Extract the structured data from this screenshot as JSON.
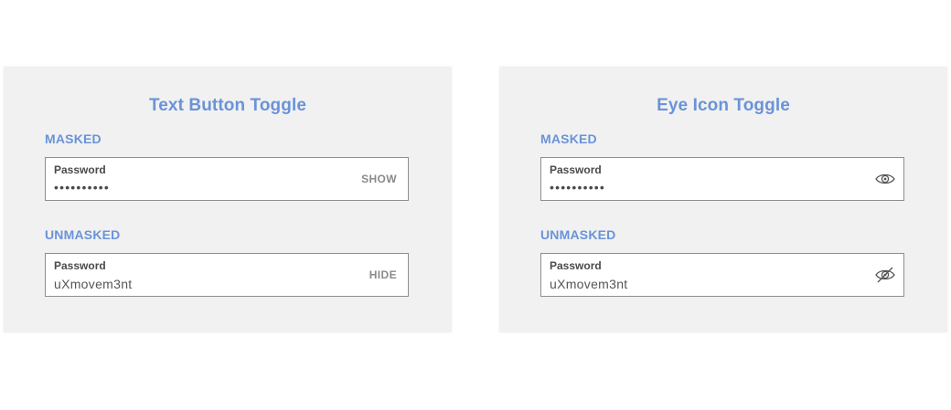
{
  "left_panel": {
    "title": "Text Button Toggle",
    "masked_section": {
      "label": "MASKED",
      "field_label": "Password",
      "value": "••••••••••",
      "toggle_label": "SHOW"
    },
    "unmasked_section": {
      "label": "UNMASKED",
      "field_label": "Password",
      "value": "uXmovem3nt",
      "toggle_label": "HIDE"
    }
  },
  "right_panel": {
    "title": "Eye Icon Toggle",
    "masked_section": {
      "label": "MASKED",
      "field_label": "Password",
      "value": "••••••••••",
      "toggle_icon": "eye-icon"
    },
    "unmasked_section": {
      "label": "UNMASKED",
      "field_label": "Password",
      "value": "uXmovem3nt",
      "toggle_icon": "eye-slash-icon"
    }
  },
  "colors": {
    "accent": "#6a93d8",
    "panel_bg": "#f1f1f1",
    "field_border": "#8e8e8e",
    "toggle_text": "#8a8a8a"
  }
}
